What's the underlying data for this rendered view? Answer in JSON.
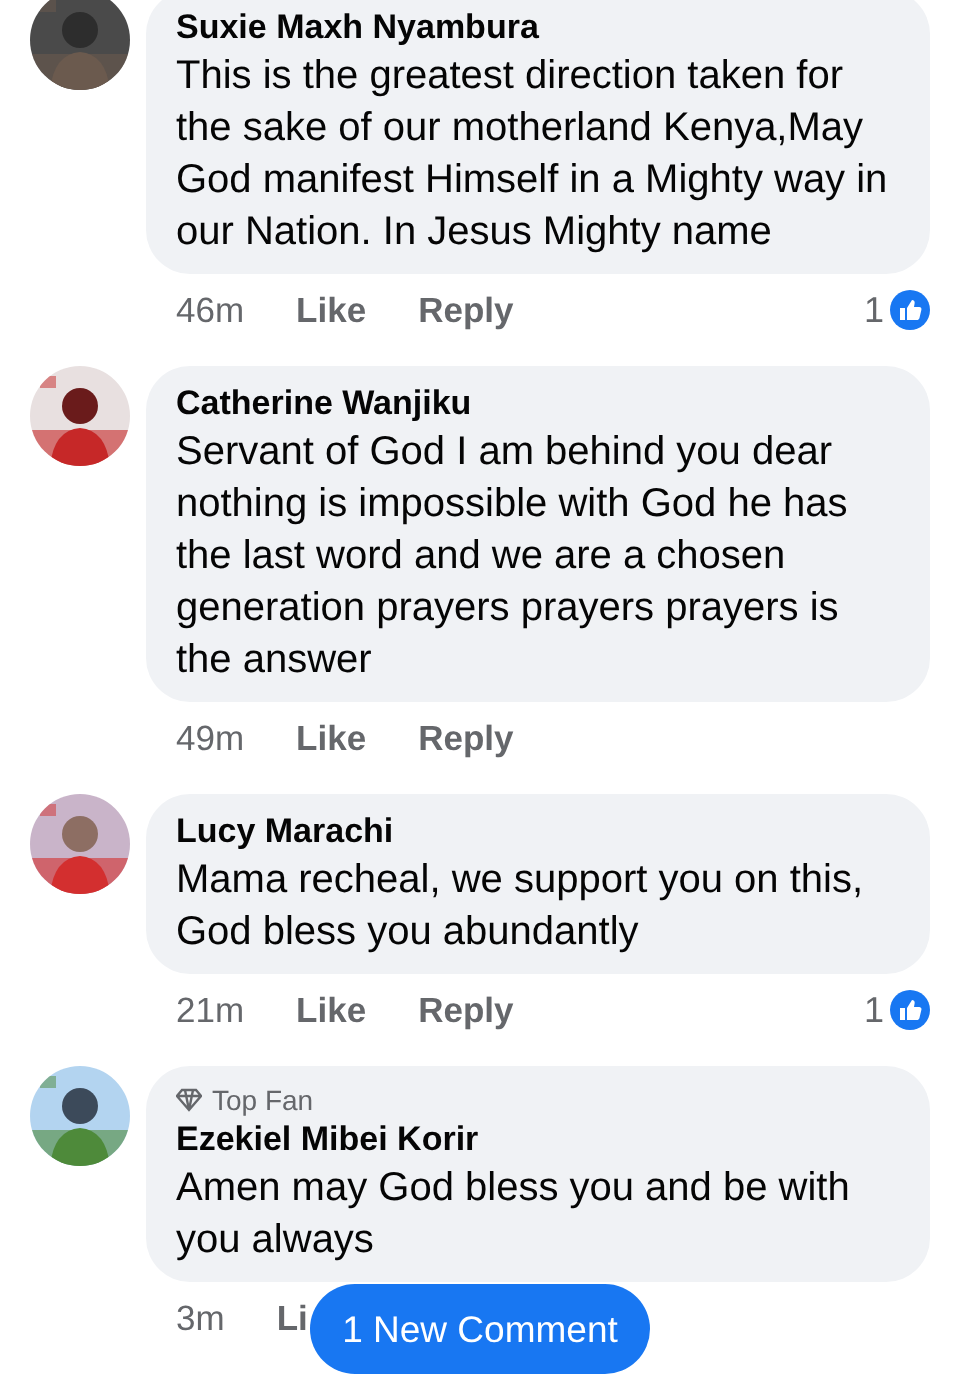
{
  "comments": [
    {
      "name": "Suxie Maxh Nyambura",
      "text": "This is the greatest direction taken for the sake of our motherland Kenya,May God manifest Himself in a Mighty way in our Nation. In Jesus Mighty name",
      "time": "46m",
      "like": "Like",
      "reply": "Reply",
      "reactions": "1"
    },
    {
      "name": "Catherine Wanjiku",
      "text": "Servant of God I am behind you dear nothing is impossible with God he has the last word and we are a chosen generation prayers prayers prayers is the answer",
      "time": "49m",
      "like": "Like",
      "reply": "Reply"
    },
    {
      "name": "Lucy Marachi",
      "text": "Mama recheal, we support you on this, God bless you abundantly",
      "time": "21m",
      "like": "Like",
      "reply": "Reply",
      "reactions": "1"
    },
    {
      "top_fan": "Top Fan",
      "name": "Ezekiel Mibei Korir",
      "text": "Amen may God bless you and be with you always",
      "time": "3m",
      "like": "Li"
    }
  ],
  "new_comment_button": "1 New Comment"
}
